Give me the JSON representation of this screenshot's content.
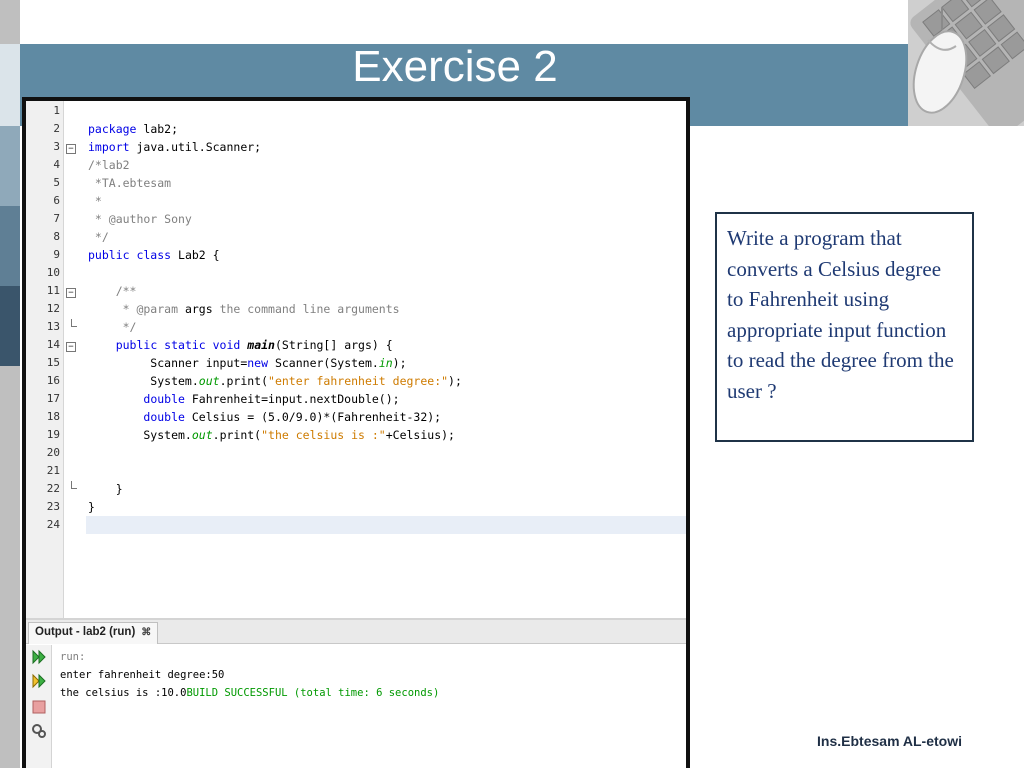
{
  "slide": {
    "title": "Exercise 2",
    "task": "Write a program that converts a Celsius degree to Fahrenheit using  appropriate input function to read the degree from the user ?",
    "author": "Ins.Ebtesam AL-etowi"
  },
  "colors": {
    "title_band": "#5f8aa3",
    "task_text": "#1f3a73",
    "keyword": "#0000e6",
    "comment": "#808080",
    "string": "#ce7b00",
    "build_success": "#009900"
  },
  "editor": {
    "line_numbers": [
      "1",
      "2",
      "3",
      "4",
      "5",
      "6",
      "7",
      "8",
      "9",
      "10",
      "11",
      "12",
      "13",
      "14",
      "15",
      "16",
      "17",
      "18",
      "19",
      "20",
      "21",
      "22",
      "23",
      "24"
    ],
    "current_line": "24"
  },
  "output": {
    "tab_label": "Output - lab2 (run)",
    "close_glyph": "⌘",
    "run_label": "run:",
    "line1": "enter fahrenheit degree:50",
    "line2_prefix": "the celsius is :10.0",
    "line2_build": "BUILD SUCCESSFUL (total time: 6 seconds)",
    "tools": [
      "rerun-icon",
      "rerun-with-options-icon",
      "stop-icon",
      "settings-icon"
    ]
  }
}
